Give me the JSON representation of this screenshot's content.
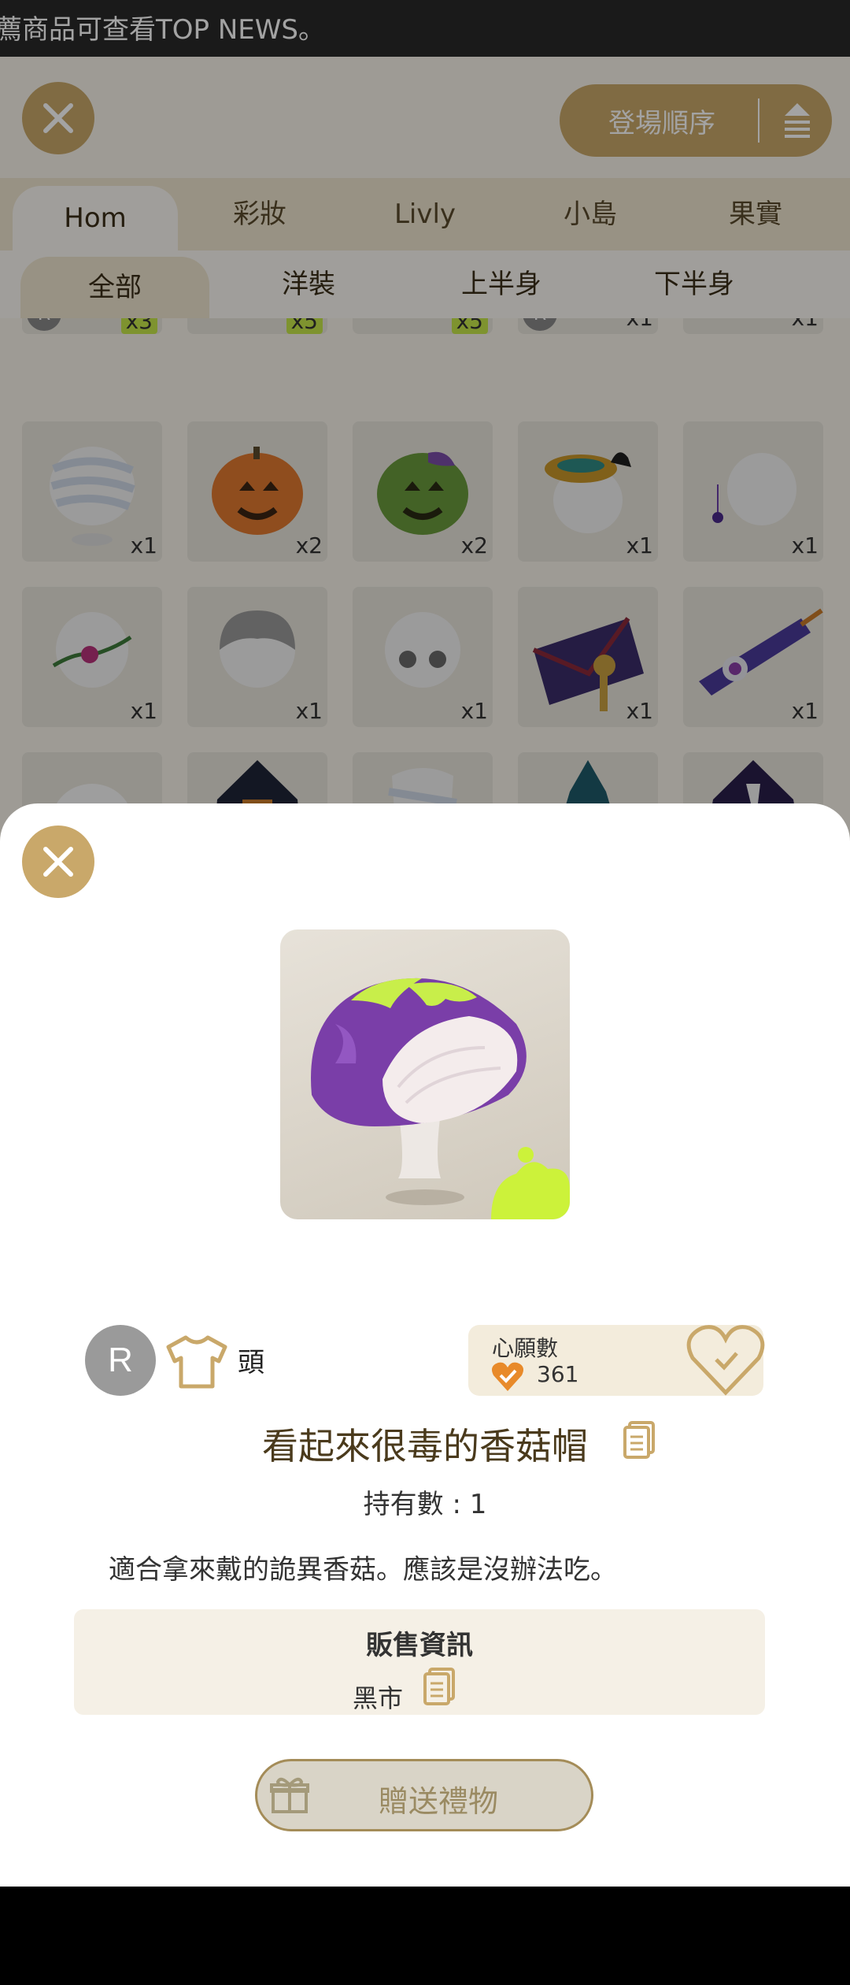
{
  "marquee": {
    "text": "薦商品可查看TOP NEWS。"
  },
  "header": {
    "sort_label": "登場順序"
  },
  "categories": [
    "Hom",
    "彩妝",
    "Livly",
    "小島",
    "果實"
  ],
  "subcategories": [
    "全部",
    "洋裝",
    "上半身",
    "下半身"
  ],
  "grid": {
    "row0_qty": [
      "x3",
      "x5",
      "x5",
      "x1",
      "x1"
    ],
    "row1_qty": [
      "x1",
      "x2",
      "x2",
      "x1",
      "x1"
    ],
    "row2_qty": [
      "x1",
      "x1",
      "x1",
      "x1",
      "x1"
    ],
    "rarity_letter": "R"
  },
  "item": {
    "rarity": "R",
    "slot": "頭",
    "name": "看起來很毒的香菇帽",
    "owned_label": "持有數 : 1",
    "description": "適合拿來戴的詭異香菇。應該是沒辦法吃。"
  },
  "wishlist": {
    "title": "心願數",
    "count": "361"
  },
  "sale": {
    "title": "販售資訊",
    "place": "黑市"
  },
  "gift": {
    "label": "贈送禮物"
  },
  "colors": {
    "gold": "#c9a86a",
    "rarity_gray": "#9a9a9a",
    "accent_green": "#c6e64a",
    "purple": "#7a3ea8"
  }
}
